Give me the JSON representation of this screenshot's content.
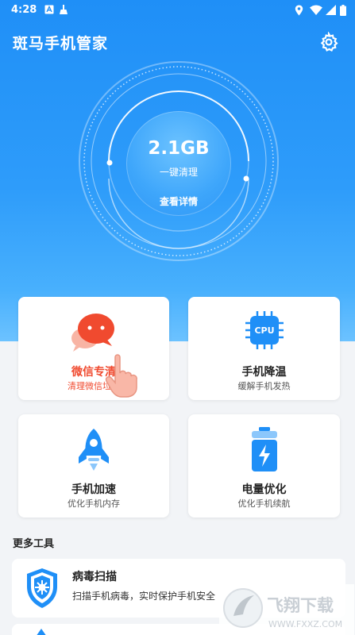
{
  "status_bar": {
    "time": "4:28"
  },
  "header": {
    "title": "斑马手机管家"
  },
  "cleaner": {
    "size": "2.1GB",
    "action": "一键清理",
    "details_link": "查看详情"
  },
  "cards": [
    {
      "title": "微信专清",
      "subtitle": "清理微信垃圾"
    },
    {
      "title": "手机降温",
      "subtitle": "缓解手机发热",
      "chip_label": "CPU"
    },
    {
      "title": "手机加速",
      "subtitle": "优化手机内存"
    },
    {
      "title": "电量优化",
      "subtitle": "优化手机续航"
    }
  ],
  "more_tools": {
    "heading": "更多工具",
    "items": [
      {
        "title": "病毒扫描",
        "desc": "扫描手机病毒，实时保护手机安全"
      }
    ]
  },
  "watermark": {
    "text": "飞翔下载",
    "url": "WWW.FXXZ.COM"
  },
  "colors": {
    "accent": "#1f8ff7",
    "wechat_red": "#f04a2f",
    "card_bg": "#ffffff"
  }
}
